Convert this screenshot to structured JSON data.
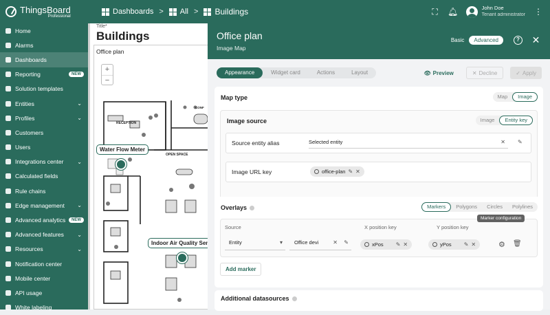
{
  "brand": {
    "name": "ThingsBoard",
    "edition": "Professional"
  },
  "breadcrumbs": [
    {
      "label": "Dashboards"
    },
    {
      "label": "All"
    },
    {
      "label": "Buildings"
    }
  ],
  "user": {
    "name": "John Doe",
    "role": "Tenant administrator"
  },
  "sidebar": {
    "items": [
      {
        "label": "Home"
      },
      {
        "label": "Alarms"
      },
      {
        "label": "Dashboards"
      },
      {
        "label": "Reporting",
        "badge": "NEW"
      },
      {
        "label": "Solution templates"
      },
      {
        "label": "Entities"
      },
      {
        "label": "Profiles"
      },
      {
        "label": "Customers"
      },
      {
        "label": "Users"
      },
      {
        "label": "Integrations center"
      },
      {
        "label": "Calculated fields"
      },
      {
        "label": "Rule chains"
      },
      {
        "label": "Edge management"
      },
      {
        "label": "Advanced analytics",
        "badge": "NEW"
      },
      {
        "label": "Advanced features"
      },
      {
        "label": "Resources"
      },
      {
        "label": "Notification center"
      },
      {
        "label": "Mobile center"
      },
      {
        "label": "API usage"
      },
      {
        "label": "White labeling"
      }
    ]
  },
  "dashboard": {
    "title_label": "Title*",
    "title": "Buildings",
    "map_label": "Office plan",
    "zoom_in": "+",
    "zoom_out": "−",
    "markers": {
      "water": "Water Flow Meter",
      "air": "Indoor Air Quality Sense"
    },
    "plan_labels": {
      "reception": "RECEPTION",
      "open_space": "OPEN SPACE",
      "conf": "CONF"
    }
  },
  "panel": {
    "title": "Office plan",
    "subtitle": "Image Map",
    "mode_basic": "Basic",
    "mode_advanced": "Advanced",
    "tabs": [
      "Appearance",
      "Widget card",
      "Actions",
      "Layout"
    ],
    "preview": "Preview",
    "decline": "Decline",
    "apply": "Apply",
    "map_type": {
      "heading": "Map type",
      "options": [
        "Map",
        "Image"
      ]
    },
    "image_source": {
      "heading": "Image source",
      "options": [
        "Image",
        "Entity key"
      ],
      "alias_label": "Source entity alias",
      "alias_value": "Selected entity",
      "url_key_label": "Image URL key",
      "url_key_value": "office-plan"
    },
    "overlays": {
      "heading": "Overlays",
      "options": [
        "Markers",
        "Polygons",
        "Circles",
        "Polylines"
      ],
      "col_source": "Source",
      "col_x": "X position key",
      "col_y": "Y position key",
      "row": {
        "source_type": "Entity",
        "source_value": "Office devi",
        "x_key": "xPos",
        "y_key": "yPos"
      },
      "tooltip": "Marker configuration",
      "add_marker": "Add marker"
    },
    "additional": {
      "heading": "Additional datasources"
    }
  },
  "colors": {
    "primary": "#2a6b5c"
  }
}
